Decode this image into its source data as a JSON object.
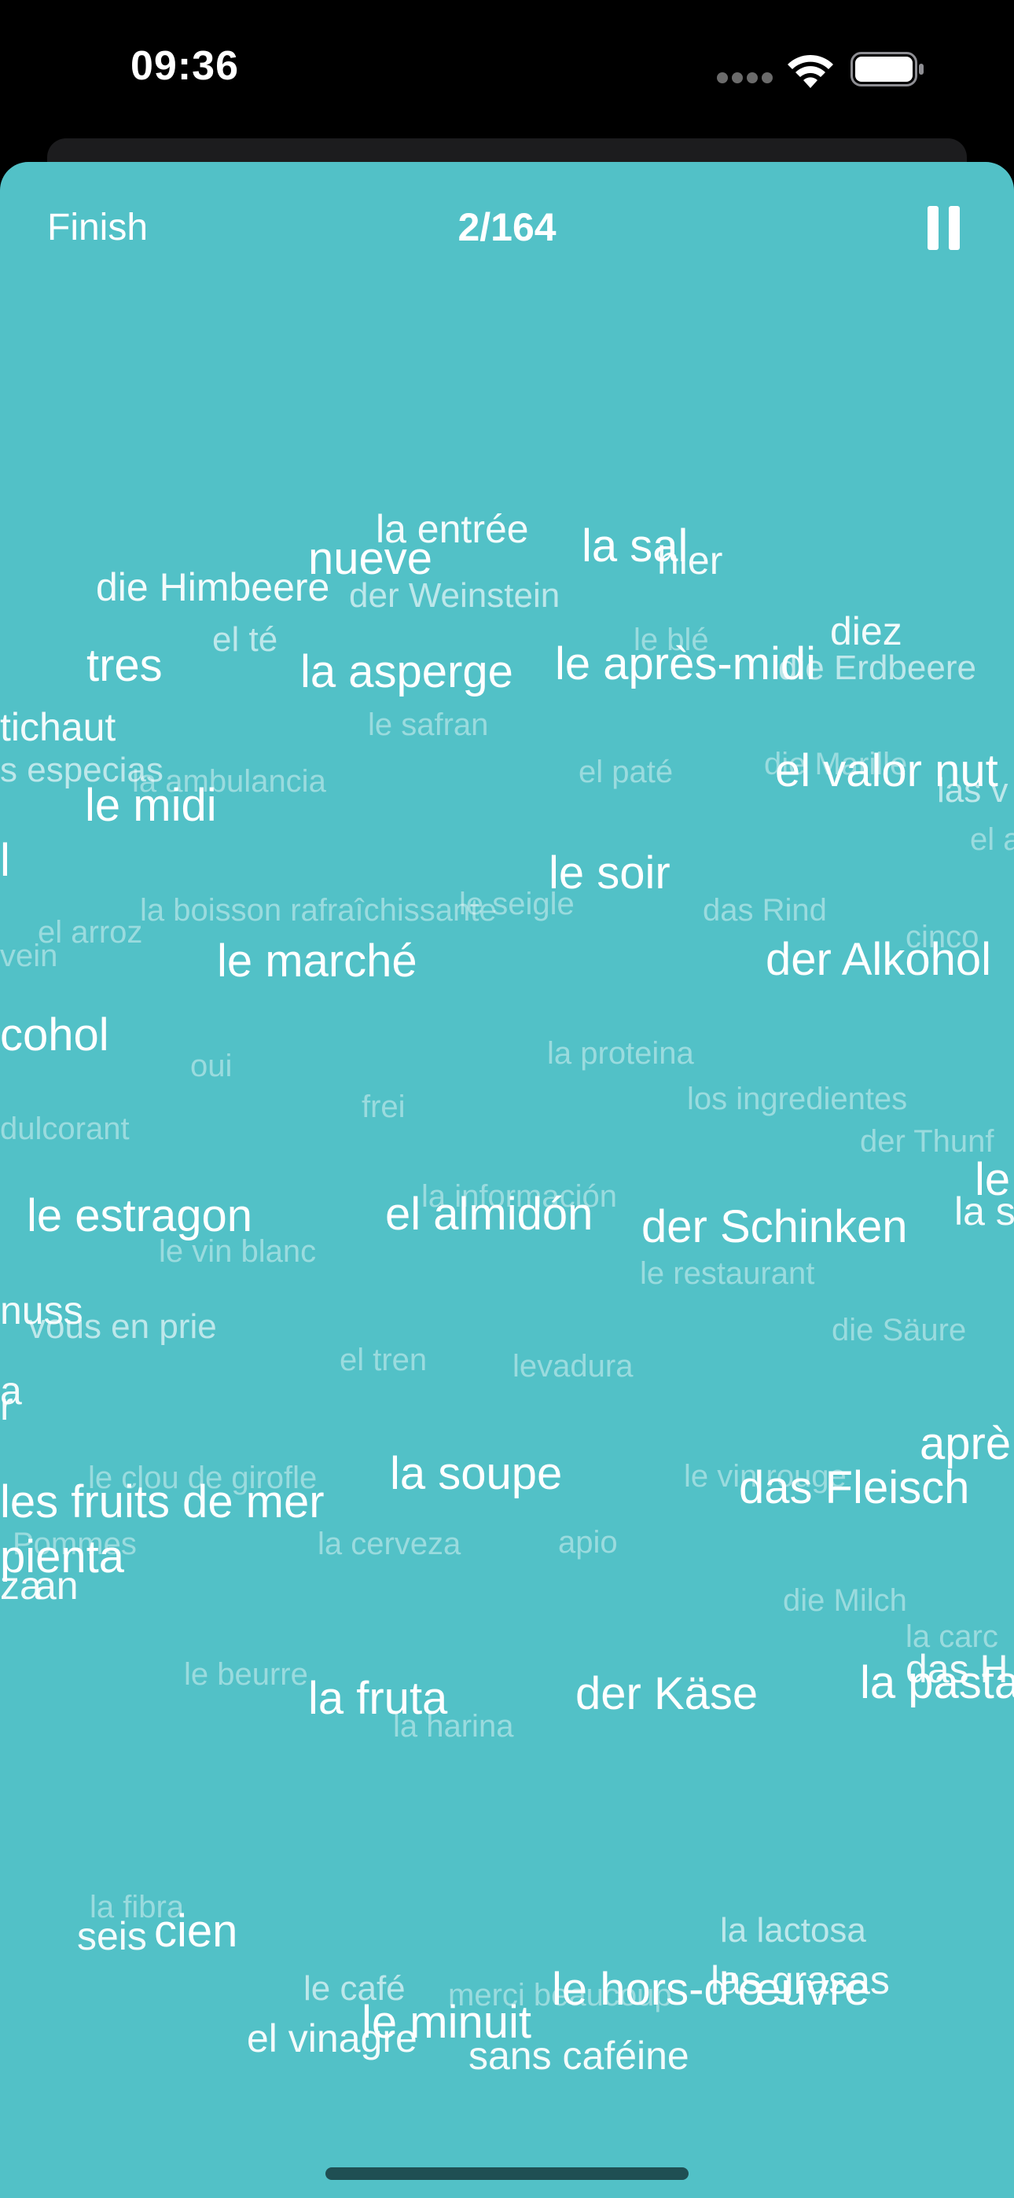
{
  "status_bar": {
    "time": "09:36"
  },
  "header": {
    "finish_label": "Finish",
    "progress": "2/164"
  },
  "colors": {
    "background": "#52c1c7",
    "status_bar": "#000000",
    "text": "#ffffff"
  },
  "icons": {
    "pause": "pause-icon",
    "wifi": "wifi-icon",
    "battery": "battery-icon",
    "signal": "cellular-signal-icon"
  },
  "words": [
    "la entrée",
    "nueve",
    "la sal",
    "hier",
    "die Himbeere",
    "der Weinstein",
    "el té",
    "le blé",
    "diez",
    "tres",
    "la asperge",
    "le après-midi",
    "die Erdbeere",
    "tichaut",
    "le safran",
    "s especias",
    "la ambulancia",
    "el paté",
    "die Marille",
    "el valor nut",
    "las v",
    "le midi",
    "el a",
    "l",
    "le soir",
    "la boisson rafraîchissante",
    "le seigle",
    "das Rind",
    "el arroz",
    "cinco",
    "vein",
    "le marché",
    "der Alkohol",
    "cohol",
    "oui",
    "la proteina",
    "frei",
    "los ingredientes",
    "dulcorant",
    "der Thunf",
    "le",
    "le estragon",
    "el almidón",
    "la información",
    "der Schinken",
    "la s",
    "le vin blanc",
    "le restaurant",
    "nuss",
    "vous en prie",
    "die Säure",
    "el tren",
    "levadura",
    "a",
    "r",
    "aprè",
    "le clou de girofle",
    "la soupe",
    "le vin rouge",
    "das Fleisch",
    "les fruits de mer",
    "Pommes",
    "la cerveza",
    "apio",
    "pienta",
    "za",
    "an",
    "die Milch",
    "la carc",
    "le beurre",
    "das H",
    "la pasta",
    "la fruta",
    "der Käse",
    "la harina",
    "la fibra",
    "seis",
    "cien",
    "la lactosa",
    "le café",
    "merci beaucoup",
    "le hors-d'œuvre",
    "las grasas",
    "el vinagre",
    "le minuit",
    "sans caféine"
  ]
}
